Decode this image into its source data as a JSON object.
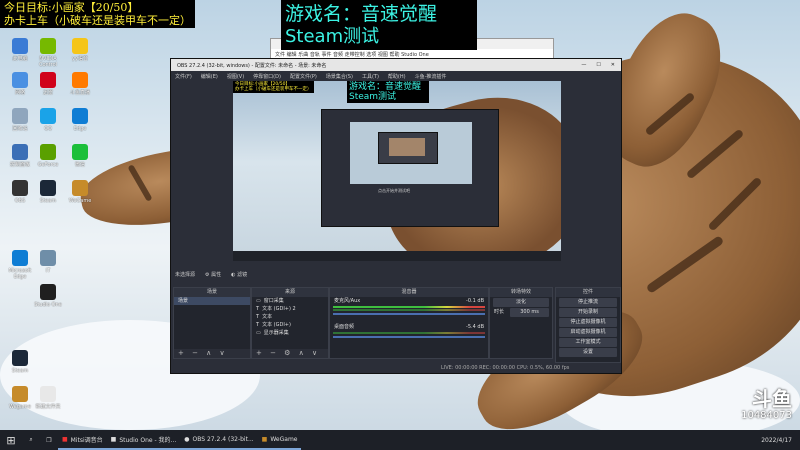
{
  "overlay": {
    "goal_line1": "今日目标:小画家【20/50】",
    "goal_line2": "办卡上车（小破车还是装甲车不一定）",
    "game_line1": "游戏名：音速觉醒",
    "game_line2": "Steam测试"
  },
  "desktop_icons": [
    {
      "label": "此电脑"
    },
    {
      "label": "NVIDIA Control"
    },
    {
      "label": "yy语音"
    },
    {
      "label": "网络"
    },
    {
      "label": "迅雷"
    },
    {
      "label": "斗鱼直播"
    },
    {
      "label": "回收站"
    },
    {
      "label": "QQ"
    },
    {
      "label": "Edge"
    },
    {
      "label": "控制面板"
    },
    {
      "label": "GeForce"
    },
    {
      "label": "微信"
    },
    {
      "label": "OBS"
    },
    {
      "label": "Steam"
    },
    {
      "label": "WeGame"
    },
    {
      "label": "Microsoft Edge"
    },
    {
      "label": "IT"
    },
    {
      "label": "Studio One"
    },
    {
      "label": "Steam"
    },
    {
      "label": "Wegame"
    },
    {
      "label": "新建文件夹"
    }
  ],
  "bg_window": {
    "menu": [
      "文件",
      "编辑",
      "乐曲",
      "音轨",
      "事件",
      "音频",
      "走带控制",
      "选项",
      "视图",
      "帮助",
      "Studio One"
    ]
  },
  "obs": {
    "title": "OBS 27.2.4 (32-bit, windows) - 配置文件: 未命名 - 场景: 未命名",
    "menu": [
      "文件(F)",
      "编辑(E)",
      "视图(V)",
      "停靠窗口(D)",
      "配置文件(P)",
      "场景集合(S)",
      "工具(T)",
      "帮助(H)",
      "斗鱼-推流插件"
    ],
    "preview_caption": "点击开始并测试吧",
    "no_source": "未选择源",
    "props_label": "属性",
    "filters_label": "滤镜",
    "docks": {
      "scenes": {
        "title": "场景",
        "items": [
          "场景"
        ]
      },
      "sources": {
        "title": "来源",
        "items": [
          "窗口采集",
          "文本 (GDI+) 2",
          "文本",
          "文本 (GDI+)",
          "显示器采集"
        ]
      },
      "mixer": {
        "title": "混音器",
        "tracks": [
          {
            "name": "桌面音频",
            "db": "-5.4 dB"
          },
          {
            "name": "麦克风/Aux",
            "db": "-0.1 dB"
          }
        ]
      },
      "transitions": {
        "title": "转场特效",
        "type": "淡化",
        "duration_label": "时长",
        "duration": "300 ms"
      },
      "controls": {
        "title": "控件",
        "buttons": [
          "停止推流",
          "开始录制",
          "停止虚拟摄像机",
          "启动虚拟摄像机",
          "工作室模式",
          "设置",
          "退出"
        ]
      }
    },
    "status": "LIVE: 00:00:00   REC: 00:00:00   CPU: 0.5%, 60.00 fps"
  },
  "taskbar": {
    "items": [
      "Mitsi调音台",
      "Studio One - 我的...",
      "OBS 27.2.4 (32-bit...",
      "WeGame"
    ]
  },
  "watermark": {
    "brand": "斗鱼",
    "room": "10484073",
    "date": "2022/4/17"
  },
  "colors": {
    "accent": "#3cf2e3",
    "goal_text": "#ffef3a",
    "taskbar": "#1d2027"
  }
}
